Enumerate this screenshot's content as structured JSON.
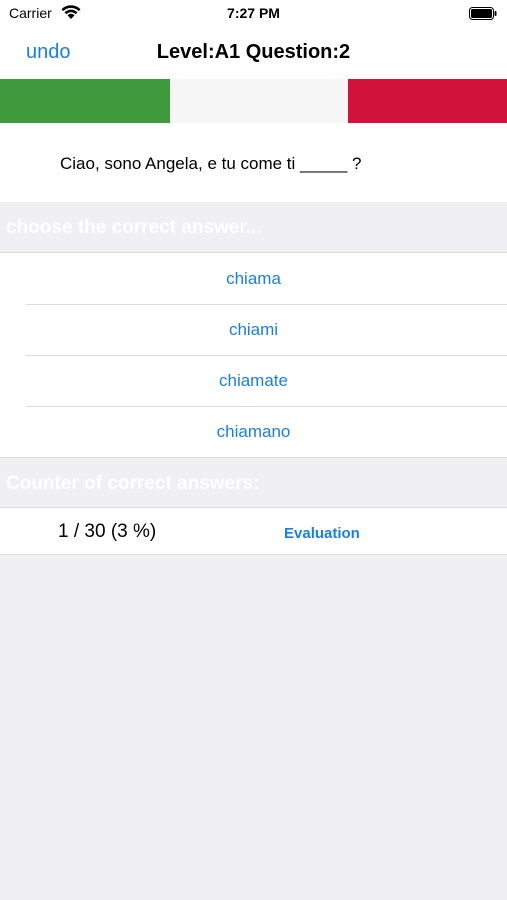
{
  "status_bar": {
    "carrier": "Carrier",
    "time": "7:27 PM"
  },
  "nav": {
    "undo_label": "undo",
    "title": "Level:A1 Question:2"
  },
  "flag": {
    "colors": [
      "#3f9a3d",
      "#f6f6f6",
      "#d1123a"
    ]
  },
  "question": {
    "text": "Ciao, sono Angela, e tu come ti _____ ?"
  },
  "choose_header": "choose the correct answer...",
  "answers": [
    {
      "label": "chiama"
    },
    {
      "label": "chiami"
    },
    {
      "label": "chiamate"
    },
    {
      "label": "chiamano"
    }
  ],
  "counter": {
    "header": "Counter of correct answers:",
    "value": "1 / 30 (3 %)",
    "evaluation_label": "Evaluation"
  },
  "colors": {
    "accent": "#1a7fe0",
    "background": "#efeff4"
  }
}
